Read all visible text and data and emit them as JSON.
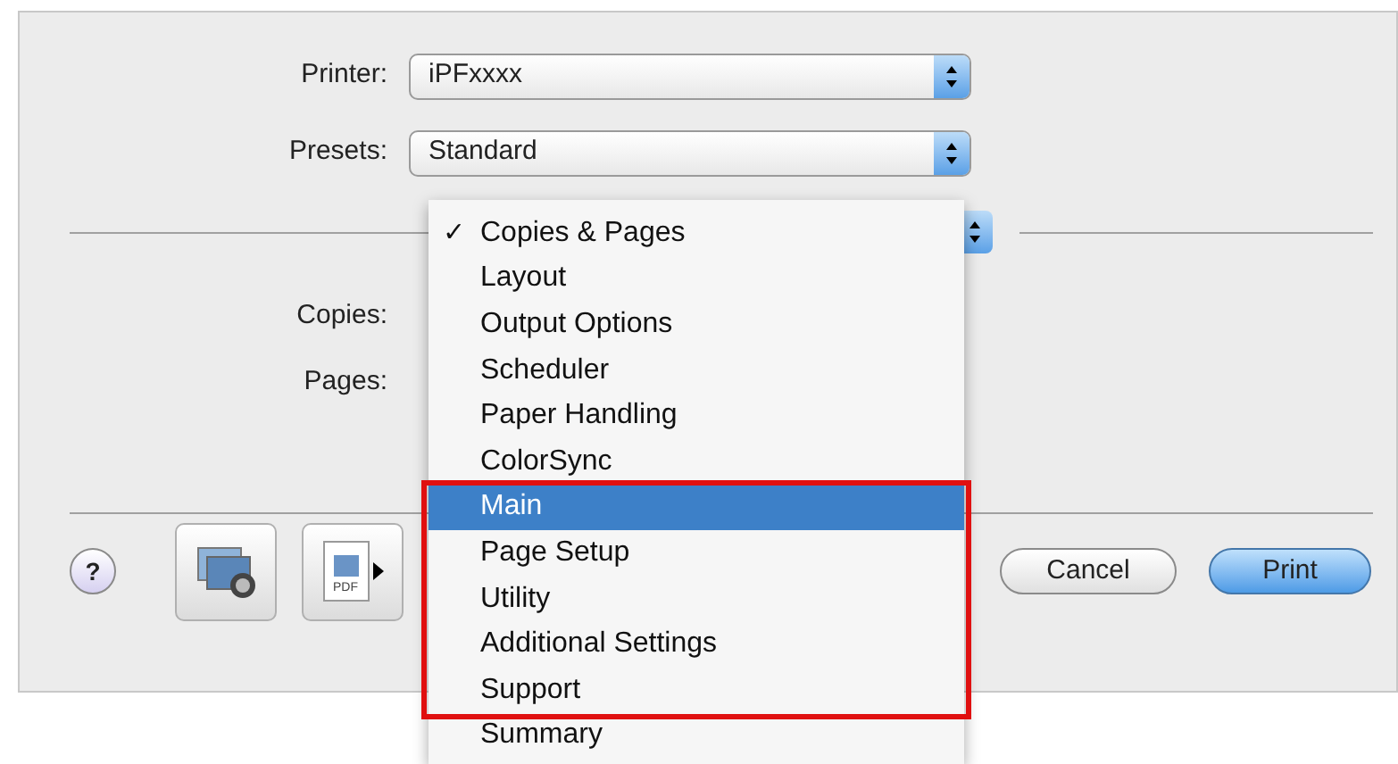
{
  "printer": {
    "label": "Printer:",
    "value": "iPFxxxx"
  },
  "presets": {
    "label": "Presets:",
    "value": "Standard"
  },
  "copies_label": "Copies:",
  "pages_label": "Pages:",
  "menu_sections": [
    {
      "outlined": false,
      "items": [
        {
          "label": "Copies & Pages",
          "checked": true,
          "selected": false
        },
        {
          "label": "Layout",
          "checked": false,
          "selected": false
        },
        {
          "label": "Output Options",
          "checked": false,
          "selected": false
        },
        {
          "label": "Scheduler",
          "checked": false,
          "selected": false
        },
        {
          "label": "Paper Handling",
          "checked": false,
          "selected": false
        },
        {
          "label": "ColorSync",
          "checked": false,
          "selected": false
        }
      ]
    },
    {
      "outlined": true,
      "items": [
        {
          "label": "Main",
          "checked": false,
          "selected": true
        },
        {
          "label": "Page Setup",
          "checked": false,
          "selected": false
        },
        {
          "label": "Utility",
          "checked": false,
          "selected": false
        },
        {
          "label": "Additional Settings",
          "checked": false,
          "selected": false
        },
        {
          "label": "Support",
          "checked": false,
          "selected": false
        }
      ]
    },
    {
      "outlined": false,
      "items": [
        {
          "label": "Summary",
          "checked": false,
          "selected": false
        }
      ]
    }
  ],
  "check_mark": "✓",
  "help": "?",
  "pdf_label": "PDF",
  "buttons": [
    {
      "label": "Cancel",
      "kind": "normal"
    },
    {
      "label": "Print",
      "kind": "default"
    }
  ]
}
